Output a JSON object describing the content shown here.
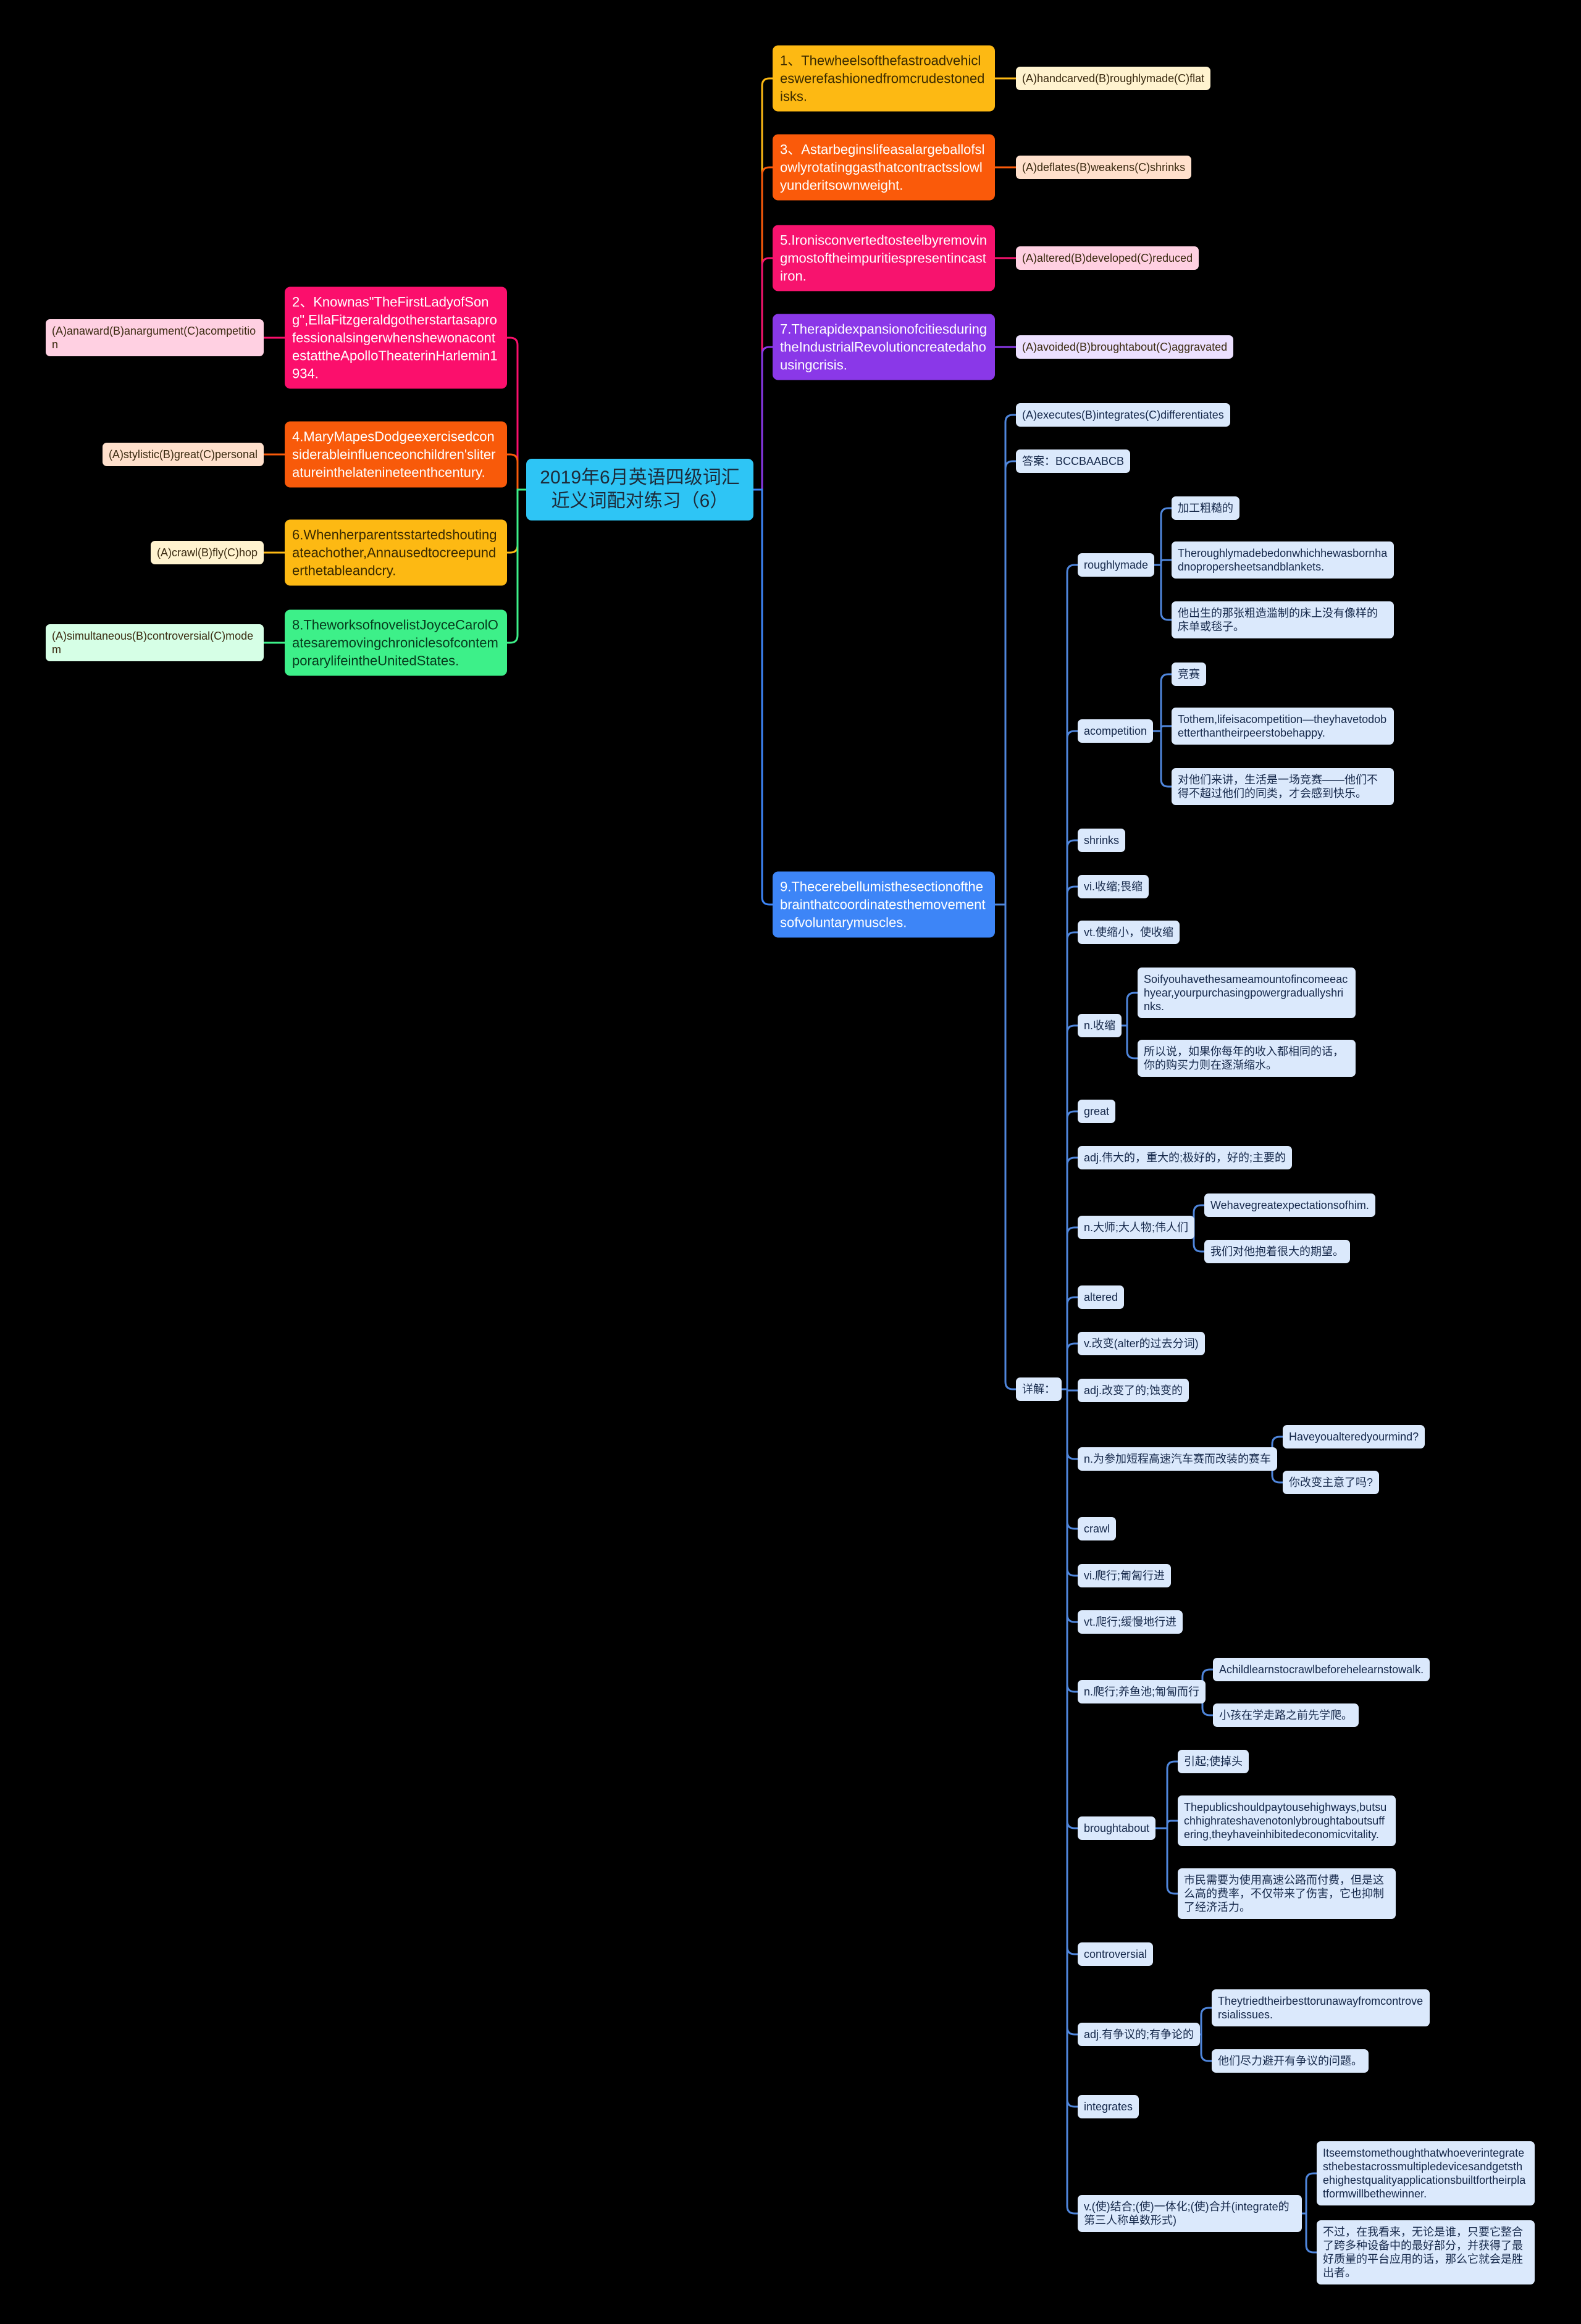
{
  "title": "2019年6月英语四级词汇近义词配对练习（6）",
  "colors": {
    "q1": "#fdb913",
    "q3": "#fa5a0a",
    "q5": "#f7136e",
    "q7": "#8a38e8",
    "q9": "#3d85f7",
    "q2": "#fb0f6c",
    "q4": "#f85a0a",
    "q6": "#fdb913",
    "q8": "#3df089",
    "detail_bg": "#dbe9fc",
    "detail_line": "#4f86dc"
  },
  "right": [
    {
      "text": "1、Thewheelsofthefastroadvehicleswerefashionedfromcrudestonedisks.",
      "options": "(A)handcarved(B)roughlymade(C)flat"
    },
    {
      "text": "3、Astarbeginslifeasalargeballofslowlyrotatinggasthatcontractsslowlyunderitsownweight.",
      "options": "(A)deflates(B)weakens(C)shrinks"
    },
    {
      "text": "5.Ironisconvertedtosteelbyremovingmostoftheimpuritiespresentincastiron.",
      "options": "(A)altered(B)developed(C)reduced"
    },
    {
      "text": "7.TherapidexpansionofcitiesduringtheIndustrialRevolutioncreatedahousingcrisis.",
      "options": "(A)avoided(B)broughtabout(C)aggravated"
    }
  ],
  "left": [
    {
      "text": "2、Knownas\"TheFirstLadyofSong\",EllaFitzgeraldgotherstartasaprofessionalsingerwhenshewonacontestattheApolloTheaterinHarlemin1934.",
      "options": "(A)anaward(B)anargument(C)acompetition"
    },
    {
      "text": "4.MaryMapesDodgeexercisedconsiderableinfluenceonchildren'sliteratureinthelatenineteenthcentury.",
      "options": "(A)stylistic(B)great(C)personal"
    },
    {
      "text": "6.Whenherparentsstartedshoutingateachother,Annausedtocreepunderthetableandcry.",
      "options": "(A)crawl(B)fly(C)hop"
    },
    {
      "text": "8.TheworksofnovelistJoyceCarolOatesaremovingchroniclesofcontemporarylifeintheUnitedStates.",
      "options": "(A)simultaneous(B)controversial(C)modem"
    }
  ],
  "q9": {
    "text": "9.Thecerebellumisthesectionofthebrainthatcoordinatesthemovementsofvoluntarymuscles.",
    "options": "(A)executes(B)integrates(C)differentiates",
    "answer": "答案：BCCBAABCB",
    "detail_label": "详解：",
    "details": [
      {
        "label": "roughlymade",
        "children": [
          "加工粗糙的",
          "Theroughlymadebedonwhichhewasbornhadnopropersheetsandblankets.",
          "他出生的那张粗造滥制的床上没有像样的床单或毯子。"
        ]
      },
      {
        "label": "acompetition",
        "children": [
          "竞赛",
          "Tothem,lifeisacompetition—theyhavetodobetterthantheirpeerstobehappy.",
          "对他们来讲，生活是一场竞赛——他们不得不超过他们的同类，才会感到快乐。"
        ]
      },
      {
        "label": "shrinks"
      },
      {
        "label": "vi.收缩;畏缩"
      },
      {
        "label": "vt.使缩小，使收缩"
      },
      {
        "label": "n.收缩",
        "children": [
          "Soifyouhavethesameamountofincomeeachyear,yourpurchasingpowergraduallyshrinks.",
          "所以说，如果你每年的收入都相同的话，你的购买力则在逐渐缩水。"
        ]
      },
      {
        "label": "great"
      },
      {
        "label": "adj.伟大的，重大的;极好的，好的;主要的"
      },
      {
        "label": "n.大师;大人物;伟人们",
        "children": [
          "Wehavegreatexpectationsofhim.",
          "我们对他抱着很大的期望。"
        ]
      },
      {
        "label": "altered"
      },
      {
        "label": "v.改变(alter的过去分词)"
      },
      {
        "label": "adj.改变了的;蚀变的"
      },
      {
        "label": "n.为参加短程高速汽车赛而改装的赛车",
        "children": [
          "Haveyoualteredyourmind?",
          "你改变主意了吗?"
        ]
      },
      {
        "label": "crawl"
      },
      {
        "label": "vi.爬行;匍匐行进"
      },
      {
        "label": "vt.爬行;缓慢地行进"
      },
      {
        "label": "n.爬行;养鱼池;匍匐而行",
        "children": [
          "Achildlearnstocrawlbeforehelearnstowalk.",
          "小孩在学走路之前先学爬。"
        ]
      },
      {
        "label": "broughtabout",
        "children": [
          "引起;使掉头",
          "Thepublicshouldpaytousehighways,butsuchhighrateshavenotonlybroughtaboutsuffering,theyhaveinhibitedeconomicvitality.",
          "市民需要为使用高速公路而付费，但是这么高的费率，不仅带来了伤害，它也抑制了经济活力。"
        ]
      },
      {
        "label": "controversial"
      },
      {
        "label": "adj.有争议的;有争论的",
        "children": [
          "Theytriedtheirbesttorunawayfromcontroversialissues.",
          "他们尽力避开有争议的问题。"
        ]
      },
      {
        "label": "integrates"
      },
      {
        "label": "v.(使)结合;(使)一体化;(使)合并(integrate的第三人称单数形式)",
        "children": [
          "Itseemstomethoughthatwhoeverintegratesthebestacrossmultipledevicesandgetsthehighestqualityapplicationsbuiltfortheirplatformwillbethewinner.",
          "不过，在我看来，无论是谁，只要它整合了跨多种设备中的最好部分，并获得了最好质量的平台应用的话，那么它就会是胜出者。"
        ]
      }
    ]
  }
}
